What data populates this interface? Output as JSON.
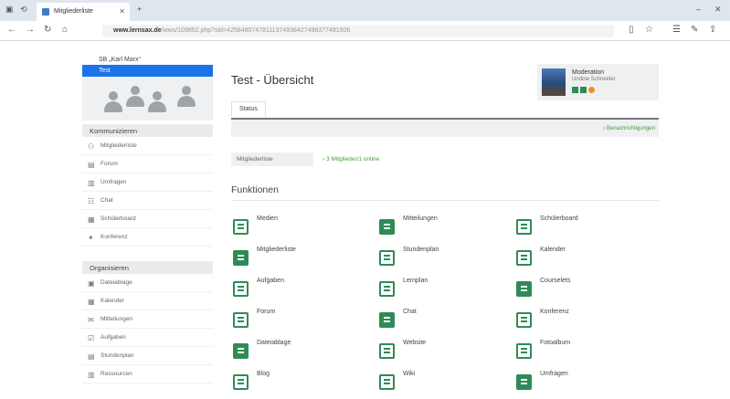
{
  "browser": {
    "tab_title": "Mitgliederliste",
    "url_host": "www.lernsax.de",
    "url_rest": "/wws/109852.php?sid=42584807478111374938427498377481506"
  },
  "sidebar": {
    "school": "SB „Karl Marx“",
    "course": "Test",
    "section_comm": "Kommunizieren",
    "comm_items": [
      {
        "label": "Mitgliederliste",
        "icon": "members-icon",
        "glyph": "⚇"
      },
      {
        "label": "Forum",
        "icon": "forum-icon",
        "glyph": "▤"
      },
      {
        "label": "Umfragen",
        "icon": "survey-icon",
        "glyph": "▥"
      },
      {
        "label": "Chat",
        "icon": "chat-icon",
        "glyph": "☷"
      },
      {
        "label": "Schülerboard",
        "icon": "board-icon",
        "glyph": "▦"
      },
      {
        "label": "Konferenz",
        "icon": "conference-icon",
        "glyph": "✦"
      }
    ],
    "section_org": "Organisieren",
    "org_items": [
      {
        "label": "Dateiablage",
        "icon": "files-icon",
        "glyph": "▣"
      },
      {
        "label": "Kalender",
        "icon": "calendar-icon",
        "glyph": "▦"
      },
      {
        "label": "Mitteilungen",
        "icon": "messages-icon",
        "glyph": "✉"
      },
      {
        "label": "Aufgaben",
        "icon": "tasks-icon",
        "glyph": "☑"
      },
      {
        "label": "Stundenplan",
        "icon": "timetable-icon",
        "glyph": "▤"
      },
      {
        "label": "Ressourcen",
        "icon": "resources-icon",
        "glyph": "▥"
      }
    ]
  },
  "main": {
    "title": "Test - Übersicht",
    "profile_name": "Moderation",
    "profile_sub": "Undine Schneider",
    "status_tab": "Status",
    "status_link": "› Benachrichtigungen",
    "members_label": "Mitgliederliste",
    "members_value": "› 3 Mitglieder/1 online",
    "functions_title": "Funktionen",
    "functions": [
      [
        "Medien",
        "Mitteilungen",
        "Schülerboard"
      ],
      [
        "Mitgliederliste",
        "Stundenplan",
        "Kalender"
      ],
      [
        "Aufgaben",
        "Lernplan",
        "Courselets"
      ],
      [
        "Forum",
        "Chat",
        "Konferenz"
      ],
      [
        "Dateiablage",
        "Website",
        "Fotoalbum"
      ],
      [
        "Blog",
        "Wiki",
        "Umfragen"
      ]
    ]
  },
  "colors": {
    "accent": "#1a73e8",
    "green": "#2e8b57"
  }
}
